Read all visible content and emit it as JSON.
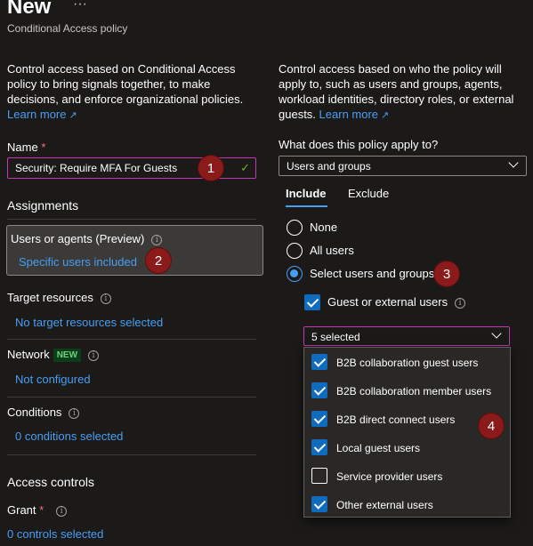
{
  "header": {
    "title": "New",
    "more_icon": "ellipsis-icon",
    "subtitle": "Conditional Access policy"
  },
  "left": {
    "description": "Control access based on Conditional Access policy to bring signals together, to make decisions, and enforce organizational policies.",
    "learn_more": "Learn more",
    "name_label": "Name",
    "required_mark": "*",
    "name_value": "Security: Require MFA For Guests",
    "assignments_heading": "Assignments",
    "users_label": "Users or agents (Preview)",
    "users_value": "Specific users included",
    "target_label": "Target resources",
    "target_value": "No target resources selected",
    "network_label": "Network",
    "network_badge": "NEW",
    "network_value": "Not configured",
    "conditions_label": "Conditions",
    "conditions_value": "0 conditions selected",
    "access_heading": "Access controls",
    "grant_label": "Grant",
    "grant_value": "0 controls selected"
  },
  "right": {
    "description": "Control access based on who the policy will apply to, such as users and groups, agents, workload identities, directory roles, or external guests.",
    "learn_more": "Learn more",
    "applies_label": "What does this policy apply to?",
    "applies_value": "Users and groups",
    "tabs": [
      {
        "label": "Include",
        "active": true
      },
      {
        "label": "Exclude",
        "active": false
      }
    ],
    "radios": [
      {
        "label": "None",
        "selected": false
      },
      {
        "label": "All users",
        "selected": false
      },
      {
        "label": "Select users and groups",
        "selected": true
      }
    ],
    "guest_checkbox_label": "Guest or external users",
    "guest_checked": true,
    "selected_value": "5 selected",
    "options": [
      {
        "label": "B2B collaboration guest users",
        "checked": true
      },
      {
        "label": "B2B collaboration member users",
        "checked": true
      },
      {
        "label": "B2B direct connect users",
        "checked": true
      },
      {
        "label": "Local guest users",
        "checked": true
      },
      {
        "label": "Service provider users",
        "checked": false
      },
      {
        "label": "Other external users",
        "checked": true
      }
    ]
  },
  "callouts": [
    "1",
    "2",
    "3",
    "4"
  ],
  "colors": {
    "background": "#1b1a19",
    "link": "#479ef5",
    "accent": "#0f6cbd",
    "callout": "#8b1a1a",
    "focus_border": "#c239b3",
    "valid": "#6bb700"
  }
}
